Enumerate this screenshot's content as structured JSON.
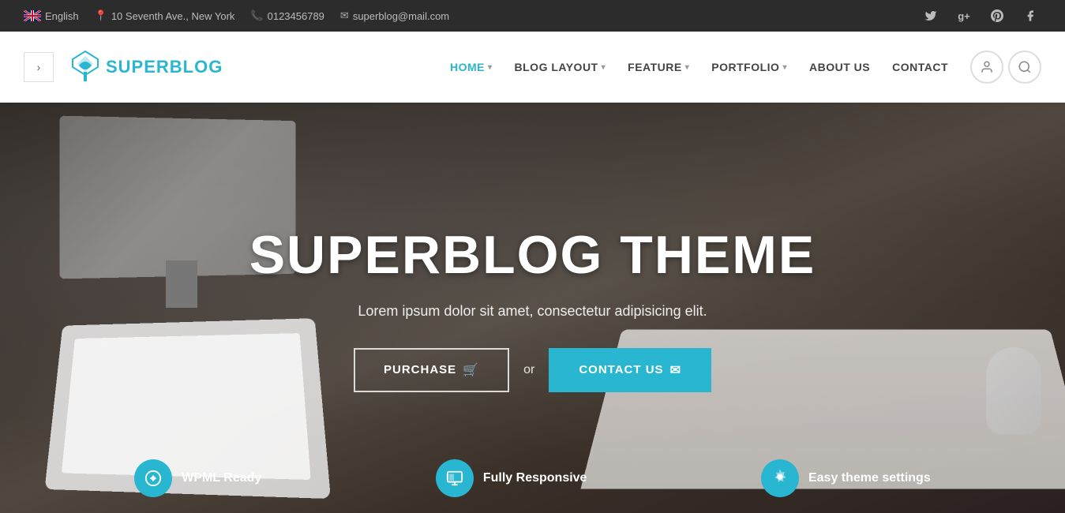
{
  "topbar": {
    "lang": "English",
    "address": "10 Seventh Ave., New York",
    "phone": "0123456789",
    "email": "superblog@mail.com"
  },
  "nav": {
    "logo_bold": "SUPER",
    "logo_light": "BLOG",
    "items": [
      {
        "label": "HOME",
        "active": true,
        "has_dropdown": true
      },
      {
        "label": "BLOG LAYOUT",
        "active": false,
        "has_dropdown": true
      },
      {
        "label": "FEATURE",
        "active": false,
        "has_dropdown": true
      },
      {
        "label": "PORTFOLIO",
        "active": false,
        "has_dropdown": true
      },
      {
        "label": "ABOUT US",
        "active": false,
        "has_dropdown": false
      },
      {
        "label": "CONTACT",
        "active": false,
        "has_dropdown": false
      }
    ]
  },
  "hero": {
    "title": "SUPERBLOG THEME",
    "subtitle": "Lorem ipsum dolor sit amet, consectetur adipisicing elit.",
    "btn_purchase": "PURCHASE",
    "or_text": "or",
    "btn_contact": "CONTACT US"
  },
  "features": [
    {
      "icon": "♀",
      "label": "WPML Ready"
    },
    {
      "icon": "▦",
      "label": "Fully Responsive"
    },
    {
      "icon": "✂",
      "label": "Easy theme settings"
    }
  ],
  "social": [
    {
      "icon": "𝕏",
      "name": "twitter"
    },
    {
      "icon": "g+",
      "name": "google-plus"
    },
    {
      "icon": "𝗣",
      "name": "pinterest"
    },
    {
      "icon": "f",
      "name": "facebook"
    }
  ]
}
